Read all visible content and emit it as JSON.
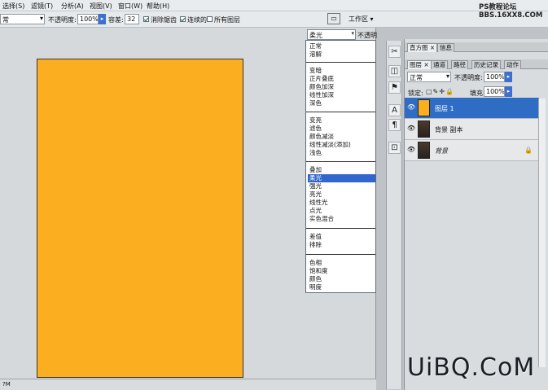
{
  "menu": [
    "选择(S)",
    "滤镜(T)",
    "分析(A)",
    "视图(V)",
    "窗口(W)",
    "帮助(H)"
  ],
  "options": {
    "mode_value": "常",
    "opacity_label": "不透明度:",
    "opacity_value": "100%",
    "tolerance_label": "容差:",
    "tolerance_value": "32",
    "antialias_label": "消除锯齿",
    "contiguous_label": "连续的",
    "all_layers_label": "所有图层"
  },
  "workspace_label": "工作区 ▾",
  "blend_dropdown": {
    "selected": "柔光",
    "opacity_label": "不透明",
    "groups": [
      [
        "正常",
        "溶解"
      ],
      [
        "变暗",
        "正片叠底",
        "颜色加深",
        "线性加深",
        "深色"
      ],
      [
        "变亮",
        "滤色",
        "颜色减淡",
        "线性减淡(添加)",
        "浅色"
      ],
      [
        "叠加",
        "柔光",
        "强光",
        "亮光",
        "线性光",
        "点光",
        "实色混合"
      ],
      [
        "差值",
        "排除"
      ],
      [
        "色相",
        "饱和度",
        "颜色",
        "明度"
      ]
    ]
  },
  "panel_tabs_top": [
    "直方图 ×",
    "信息"
  ],
  "panel_tabs_layers": [
    "图层 ×",
    "通道",
    "路径",
    "历史记录",
    "动作"
  ],
  "layers_panel": {
    "blend_value": "正常",
    "opacity_label": "不透明度:",
    "opacity_value": "100%",
    "lock_label": "锁定:",
    "fill_label": "填充:",
    "fill_value": "100%",
    "layers": [
      {
        "name": "图层 1",
        "thumb": "#fbae1f",
        "selected": true
      },
      {
        "name": "背景 副本",
        "thumb": "#3a2e2a",
        "selected": false
      },
      {
        "name": "背景",
        "thumb": "#3a2e2a",
        "selected": false,
        "locked": true
      }
    ]
  },
  "status_zoom": "?M",
  "watermark_top": "PS教程论坛",
  "watermark_top2": "BBS.16XX8.COM",
  "watermark_bottom": "UiBQ.CoM",
  "colors": {
    "canvas": "#fbae1f",
    "selection": "#3366cc",
    "layer_selected": "#2f6cc4"
  }
}
